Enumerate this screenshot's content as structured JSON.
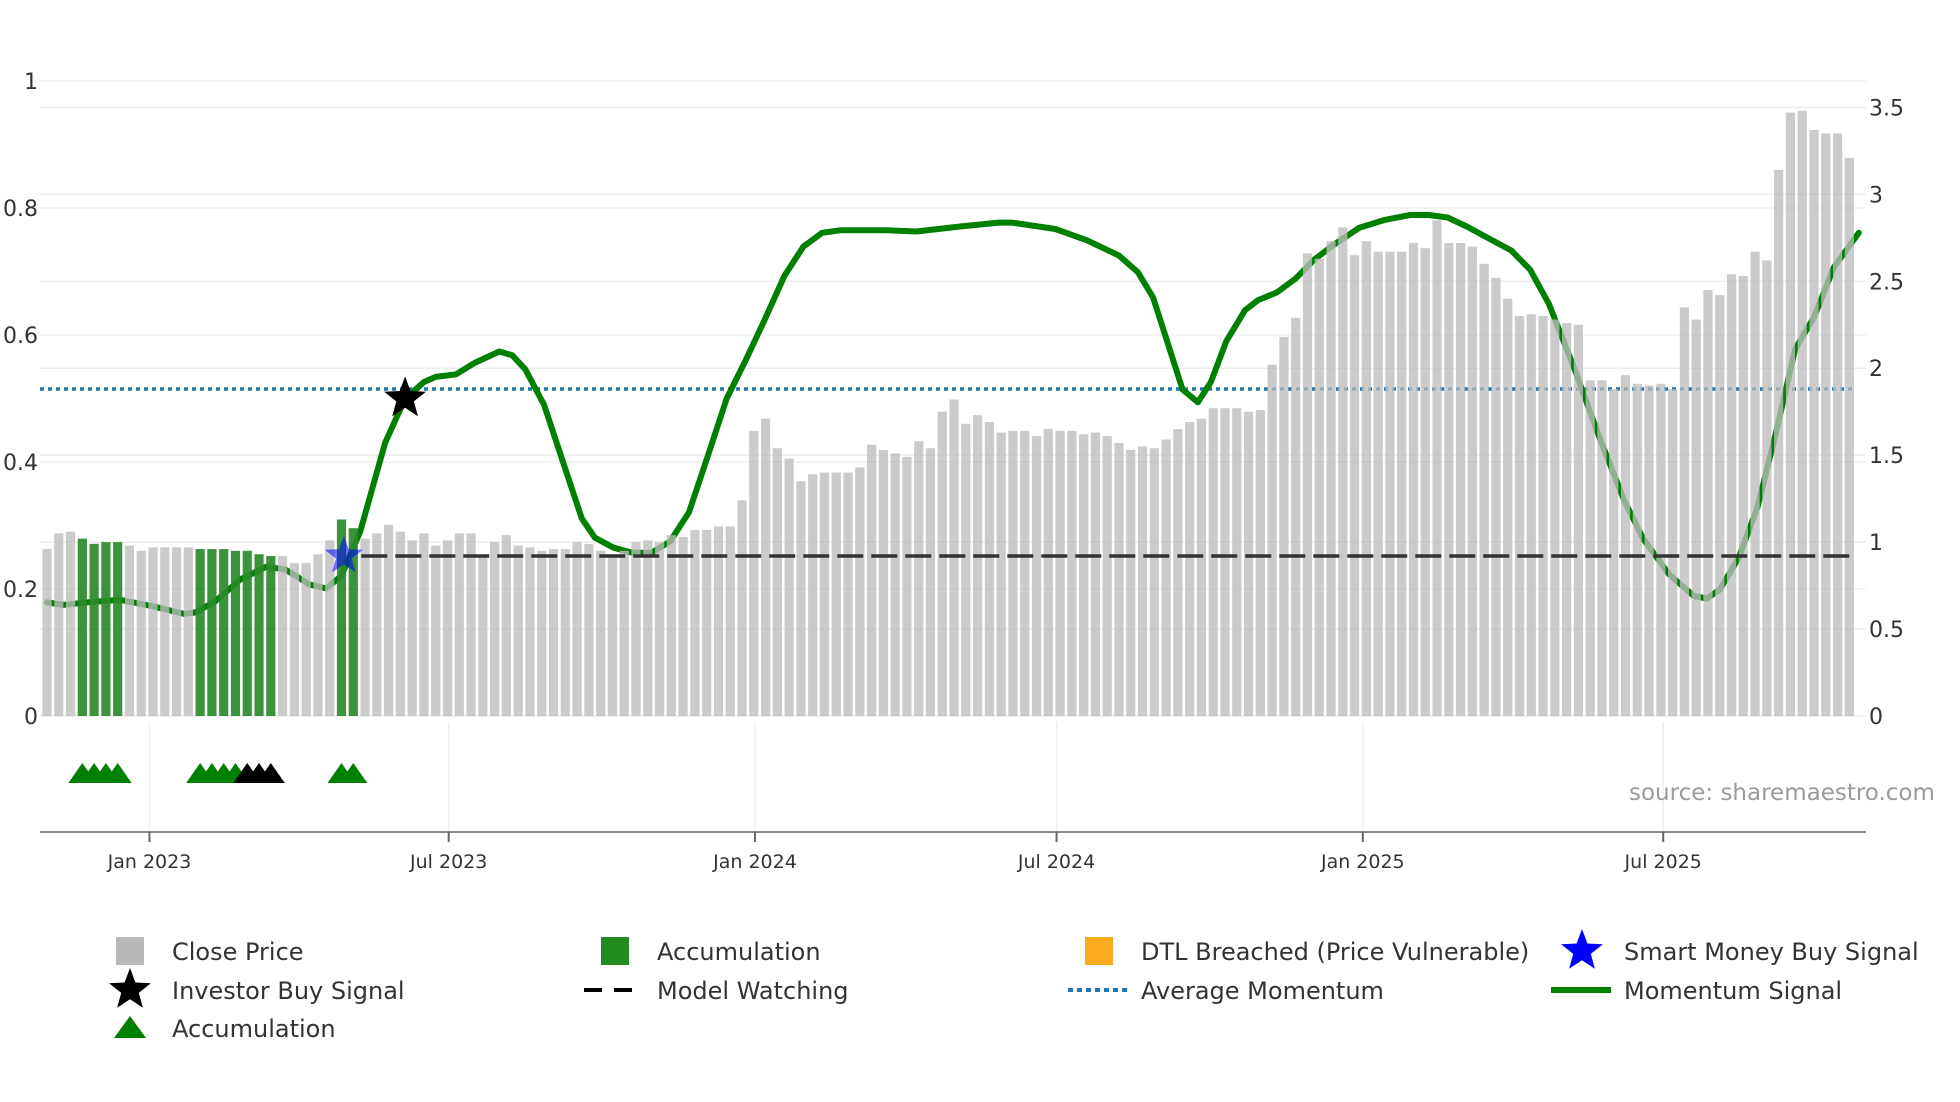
{
  "source_text": "source: sharemaestro.com",
  "colors": {
    "close_price": "#bdbdbd",
    "accumulation_bar": "#2a8a2a",
    "accumulation_marker": "#008000",
    "dtl": "#fbab1e",
    "smart_money": "#0000ff",
    "investor": "#000000",
    "model_watching": "#333333",
    "avg_momentum": "#1f77b4",
    "momentum": "#008000"
  },
  "legend": [
    {
      "label": "Close Price",
      "icon": "grey-square-icon"
    },
    {
      "label": "Accumulation",
      "icon": "green-square-icon"
    },
    {
      "label": "DTL Breached (Price Vulnerable)",
      "icon": "orange-square-icon"
    },
    {
      "label": "Smart Money Buy Signal",
      "icon": "blue-star-icon"
    },
    {
      "label": "Investor Buy Signal",
      "icon": "black-star-icon"
    },
    {
      "label": "Model Watching",
      "icon": "dashed-line-icon"
    },
    {
      "label": "Average Momentum",
      "icon": "dotted-line-icon"
    },
    {
      "label": "Momentum Signal",
      "icon": "solid-line-icon"
    },
    {
      "label": "Accumulation",
      "icon": "green-triangle-icon"
    }
  ],
  "chart_data": {
    "type": "bar",
    "x_unit": "week index",
    "left_axis": {
      "ticks": [
        "0",
        "0.2",
        "0.4",
        "0.6",
        "0.8",
        "1"
      ],
      "range": [
        0,
        1
      ]
    },
    "right_axis": {
      "ticks": [
        "0",
        "0.5",
        "1",
        "1.5",
        "2",
        "2.5",
        "3",
        "3.5"
      ],
      "range": [
        0,
        3.5
      ]
    },
    "x_ticks": [
      {
        "label": "Jan 2023",
        "at": 8.7
      },
      {
        "label": "Jul 2023",
        "at": 34.1
      },
      {
        "label": "Jan 2024",
        "at": 60.1
      },
      {
        "label": "Jul 2024",
        "at": 85.7
      },
      {
        "label": "Jan 2025",
        "at": 111.7
      },
      {
        "label": "Jul 2025",
        "at": 137.2
      }
    ],
    "close_price": [
      0.96,
      1.05,
      1.06,
      1.02,
      0.99,
      1.0,
      1.0,
      0.98,
      0.95,
      0.97,
      0.97,
      0.97,
      0.97,
      0.96,
      0.96,
      0.96,
      0.95,
      0.95,
      0.93,
      0.92,
      0.92,
      0.88,
      0.88,
      0.93,
      1.01,
      1.13,
      1.08,
      1.02,
      1.05,
      1.1,
      1.06,
      1.01,
      1.05,
      0.98,
      1.01,
      1.05,
      1.05,
      0.92,
      1.0,
      1.04,
      0.98,
      0.97,
      0.95,
      0.96,
      0.96,
      1.0,
      0.99,
      0.95,
      0.93,
      0.95,
      1.0,
      1.01,
      1.0,
      1.04,
      1.03,
      1.07,
      1.07,
      1.09,
      1.09,
      1.24,
      1.64,
      1.71,
      1.54,
      1.48,
      1.35,
      1.39,
      1.4,
      1.4,
      1.4,
      1.43,
      1.56,
      1.53,
      1.51,
      1.49,
      1.58,
      1.54,
      1.75,
      1.82,
      1.68,
      1.73,
      1.69,
      1.63,
      1.64,
      1.64,
      1.61,
      1.65,
      1.64,
      1.64,
      1.62,
      1.63,
      1.61,
      1.57,
      1.53,
      1.55,
      1.54,
      1.59,
      1.65,
      1.69,
      1.71,
      1.77,
      1.77,
      1.77,
      1.75,
      1.76,
      2.02,
      2.18,
      2.29,
      2.66,
      2.63,
      2.73,
      2.81,
      2.65,
      2.73,
      2.67,
      2.67,
      2.67,
      2.72,
      2.69,
      2.85,
      2.72,
      2.72,
      2.7,
      2.6,
      2.52,
      2.4,
      2.3,
      2.31,
      2.3,
      2.28,
      2.26,
      2.25,
      1.93,
      1.93,
      1.88,
      1.96,
      1.91,
      1.9,
      1.91,
      1.88,
      2.35,
      2.28,
      2.45,
      2.42,
      2.54,
      2.53,
      2.67,
      2.62,
      3.14,
      3.47,
      3.48,
      3.37,
      3.35,
      3.35,
      3.21
    ],
    "accumulation_bar_indices": [
      3,
      4,
      5,
      6,
      13,
      14,
      15,
      16,
      17,
      18,
      19,
      25,
      26
    ],
    "momentum_signal": [
      [
        0,
        0.179
      ],
      [
        1.4,
        0.175
      ],
      [
        3.5,
        0.179
      ],
      [
        6.2,
        0.183
      ],
      [
        8.9,
        0.173
      ],
      [
        11.6,
        0.161
      ],
      [
        12.6,
        0.163
      ],
      [
        14.3,
        0.181
      ],
      [
        16.4,
        0.215
      ],
      [
        18.6,
        0.235
      ],
      [
        20.2,
        0.231
      ],
      [
        22.3,
        0.207
      ],
      [
        23.7,
        0.201
      ],
      [
        25.0,
        0.221
      ],
      [
        26.6,
        0.291
      ],
      [
        28.7,
        0.43
      ],
      [
        30.4,
        0.5
      ],
      [
        32.0,
        0.526
      ],
      [
        33.0,
        0.534
      ],
      [
        34.7,
        0.538
      ],
      [
        36.3,
        0.556
      ],
      [
        38.4,
        0.574
      ],
      [
        39.5,
        0.568
      ],
      [
        40.6,
        0.546
      ],
      [
        42.2,
        0.49
      ],
      [
        43.8,
        0.4
      ],
      [
        45.4,
        0.311
      ],
      [
        46.5,
        0.281
      ],
      [
        48.1,
        0.265
      ],
      [
        49.7,
        0.257
      ],
      [
        51.3,
        0.257
      ],
      [
        52.9,
        0.275
      ],
      [
        54.5,
        0.321
      ],
      [
        56.1,
        0.41
      ],
      [
        57.7,
        0.5
      ],
      [
        59.3,
        0.56
      ],
      [
        60.9,
        0.623
      ],
      [
        62.6,
        0.693
      ],
      [
        64.2,
        0.739
      ],
      [
        65.8,
        0.761
      ],
      [
        67.4,
        0.765
      ],
      [
        71.1,
        0.765
      ],
      [
        73.8,
        0.763
      ],
      [
        77.6,
        0.771
      ],
      [
        80.8,
        0.777
      ],
      [
        81.9,
        0.777
      ],
      [
        85.6,
        0.767
      ],
      [
        88.3,
        0.749
      ],
      [
        91.0,
        0.725
      ],
      [
        92.6,
        0.699
      ],
      [
        93.9,
        0.659
      ],
      [
        95.3,
        0.578
      ],
      [
        96.4,
        0.514
      ],
      [
        97.7,
        0.494
      ],
      [
        98.8,
        0.526
      ],
      [
        100.1,
        0.59
      ],
      [
        101.7,
        0.639
      ],
      [
        102.8,
        0.655
      ],
      [
        104.4,
        0.667
      ],
      [
        106.0,
        0.689
      ],
      [
        107.6,
        0.719
      ],
      [
        109.3,
        0.743
      ],
      [
        111.4,
        0.769
      ],
      [
        113.5,
        0.781
      ],
      [
        115.7,
        0.789
      ],
      [
        117.3,
        0.789
      ],
      [
        118.9,
        0.785
      ],
      [
        120.5,
        0.771
      ],
      [
        122.7,
        0.749
      ],
      [
        124.3,
        0.733
      ],
      [
        125.9,
        0.703
      ],
      [
        127.5,
        0.649
      ],
      [
        129.6,
        0.55
      ],
      [
        131.8,
        0.438
      ],
      [
        133.9,
        0.339
      ],
      [
        135.5,
        0.279
      ],
      [
        137.7,
        0.223
      ],
      [
        139.8,
        0.189
      ],
      [
        140.9,
        0.185
      ],
      [
        142.0,
        0.199
      ],
      [
        143.6,
        0.249
      ],
      [
        145.2,
        0.329
      ],
      [
        146.8,
        0.448
      ],
      [
        148.4,
        0.578
      ],
      [
        150.0,
        0.628
      ],
      [
        151.7,
        0.707
      ],
      [
        153.8,
        0.761
      ]
    ],
    "average_momentum": 0.515,
    "model_watching": {
      "value": 0.92,
      "from": 26
    },
    "investor_buy_signal": {
      "at": 30.4,
      "value": 0.5
    },
    "smart_money_buy_signal": {
      "at": 25.2,
      "value": 0.92
    },
    "accumulation_markers": [
      {
        "at": 3,
        "color": "green"
      },
      {
        "at": 4,
        "color": "green"
      },
      {
        "at": 5,
        "color": "green"
      },
      {
        "at": 6,
        "color": "green"
      },
      {
        "at": 13,
        "color": "green"
      },
      {
        "at": 14,
        "color": "green"
      },
      {
        "at": 15,
        "color": "green"
      },
      {
        "at": 16,
        "color": "green"
      },
      {
        "at": 17,
        "color": "black"
      },
      {
        "at": 18,
        "color": "black"
      },
      {
        "at": 19,
        "color": "black"
      },
      {
        "at": 25,
        "color": "green"
      },
      {
        "at": 26,
        "color": "green"
      }
    ],
    "grid": true,
    "legend_position": "bottom"
  }
}
